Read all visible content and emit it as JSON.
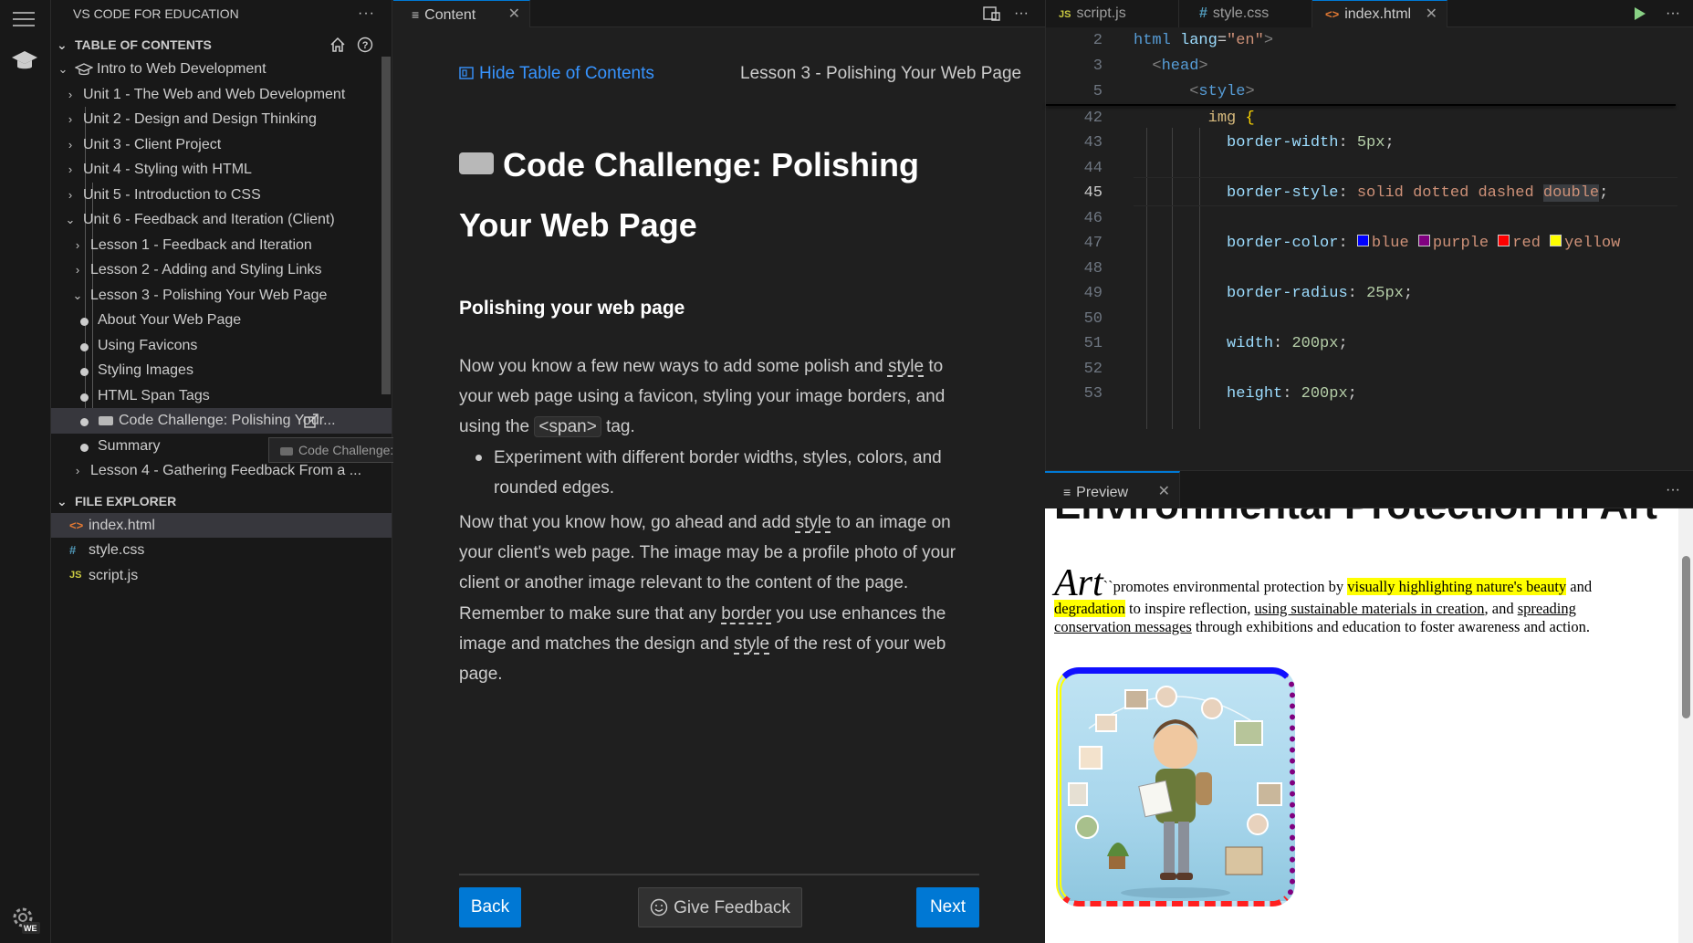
{
  "sidebar": {
    "title": "VS CODE FOR EDUCATION",
    "toc_header": "TABLE OF CONTENTS",
    "course": "Intro to Web Development",
    "units": [
      "Unit 1 - The Web and Web Development",
      "Unit 2 - Design and Design Thinking",
      "Unit 3 - Client Project",
      "Unit 4 - Styling with HTML",
      "Unit 5 - Introduction to CSS",
      "Unit 6 - Feedback and Iteration (Client)"
    ],
    "lessons": [
      "Lesson 1 - Feedback and Iteration",
      "Lesson 2 - Adding and Styling Links",
      "Lesson 3 - Polishing Your Web Page"
    ],
    "topics": [
      "About Your Web Page",
      "Using Favicons",
      "Styling Images",
      "HTML Span Tags",
      "Code Challenge: Polishing Your...",
      "Summary"
    ],
    "lesson4": "Lesson 4 - Gathering Feedback From a ...",
    "tooltip": "Code Challenge: Polishing Your Web Page",
    "explorer_header": "FILE EXPLORER",
    "files": [
      {
        "name": "index.html",
        "icon": "<>",
        "color": "#e37933"
      },
      {
        "name": "style.css",
        "icon": "#",
        "color": "#519aba"
      },
      {
        "name": "script.js",
        "icon": "JS",
        "color": "#cbcb41"
      }
    ]
  },
  "content": {
    "tab_label": "Content",
    "hide_toc": "Hide Table of Contents",
    "lesson_label": "Lesson 3 - Polishing Your Web Page",
    "title": "Code Challenge: Polishing Your Web Page",
    "subtitle": "Polishing your web page",
    "p1_a": "Now you know a few new ways to add some polish and ",
    "p1_style": "style",
    "p1_b": " to your web page using a favicon, styling your image borders, and using the ",
    "p1_span": "<span>",
    "p1_c": " tag.",
    "bullet": "Experiment with different border widths, styles, colors, and rounded edges.",
    "p2_a": "Now that you know how, go ahead and add ",
    "p2_style": "style",
    "p2_b": " to an image on your client's web page. The image may be a profile photo of your client or another image relevant to the content of the page.",
    "p3_a": "Remember to make sure that any ",
    "p3_border": "border",
    "p3_b": " you use enhances the image and matches the design and ",
    "p3_style": "style",
    "p3_c": " of the rest of your web page.",
    "back": "Back",
    "feedback": "Give Feedback",
    "next": "Next"
  },
  "editor": {
    "tabs": [
      "script.js",
      "style.css",
      "index.html"
    ],
    "lines": {
      "l2": "2",
      "l3": "3",
      "l5": "5",
      "l42": "42",
      "l43": "43",
      "l44": "44",
      "l45": "45",
      "l46": "46",
      "l47": "47",
      "l48": "48",
      "l49": "49",
      "l50": "50",
      "l51": "51",
      "l52": "52",
      "l53": "53"
    },
    "code": {
      "html_tag": "html",
      "lang_attr": "lang",
      "lang_val": "\"en\"",
      "head": "head",
      "style": "style",
      "img_sel": "img",
      "bw_prop": "border-width",
      "bw_val": "5px",
      "bs_prop": "border-style",
      "bs_val": "solid dotted dashed",
      "bs_val2": "double",
      "bc_prop": "border-color",
      "bc_blue": "blue",
      "bc_purple": "purple",
      "bc_red": "red",
      "bc_yellow": "yellow",
      "br_prop": "border-radius",
      "br_val": "25px",
      "w_prop": "width",
      "w_val": "200px",
      "h_prop": "height",
      "h_val": "200px"
    }
  },
  "preview": {
    "tab_label": "Preview",
    "heading": "Environmental Protection in Art",
    "lead_word": "Art",
    "p_a": "``promotes environmental protection by ",
    "p_hl1": "visually highlighting nature's beauty",
    "p_b": " and ",
    "p_hl2": "degradation",
    "p_c": " to inspire reflection, ",
    "p_ul1": "using sustainable materials in creation",
    "p_d": ", and ",
    "p_ul2": "spreading conservation messages",
    "p_e": " through exhibitions and education to foster awareness and action."
  },
  "colors": {
    "accent": "#0078d4",
    "link": "#3794ff",
    "swatch_blue": "#0000ff",
    "swatch_purple": "#800080",
    "swatch_red": "#ff0000",
    "swatch_yellow": "#ffff00"
  }
}
